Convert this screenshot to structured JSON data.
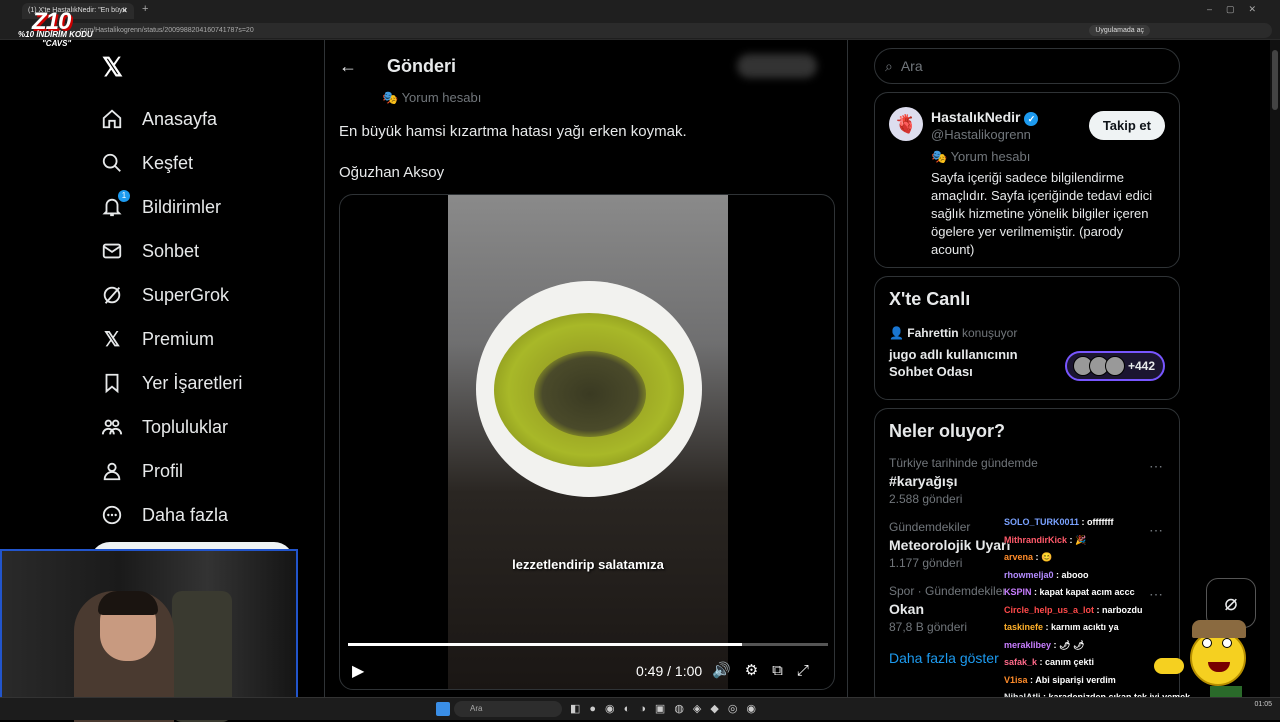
{
  "browser": {
    "tab_title": "(1) X'te HastalıkNedir: \"En büyü",
    "url": ".com/Hastalikogrenn/status/2009988204160741787s=20",
    "open_in_app": "Uygulamada aç"
  },
  "overlay": {
    "logo": "Z10",
    "promo_line1": "%10 İNDİRİM KODU",
    "promo_line2": "\"CAVS\""
  },
  "nav": {
    "items": [
      {
        "label": "Anasayfa",
        "icon": "home-icon"
      },
      {
        "label": "Keşfet",
        "icon": "search-icon"
      },
      {
        "label": "Bildirimler",
        "icon": "bell-icon",
        "badge": "1"
      },
      {
        "label": "Sohbet",
        "icon": "mail-icon"
      },
      {
        "label": "SuperGrok",
        "icon": "grok-icon"
      },
      {
        "label": "Premium",
        "icon": "x-icon"
      },
      {
        "label": "Yer İşaretleri",
        "icon": "bookmark-icon"
      },
      {
        "label": "Topluluklar",
        "icon": "communities-icon"
      },
      {
        "label": "Profil",
        "icon": "profile-icon"
      },
      {
        "label": "Daha fazla",
        "icon": "more-icon"
      }
    ]
  },
  "post": {
    "header_title": "Gönderi",
    "yorum_label": "Yorum hesabı",
    "text": "En büyük hamsi kızartma hatası yağı erken koymak.",
    "author_line": "Oğuzhan Aksoy",
    "video": {
      "caption": "lezzetlendirip salatamıza",
      "time": "0:49 / 1:00",
      "progress": 0.82
    }
  },
  "right": {
    "search_placeholder": "Ara",
    "profile": {
      "name": "HastalıkNedir",
      "handle": "@Hastalikogrenn",
      "yorum_label": "Yorum hesabı",
      "bio": "Sayfa içeriği sadece bilgilendirme amaçlıdır. Sayfa içeriğinde tedavi edici sağlık hizmetine yönelik bilgiler içeren ögelere yer verilmemiştir. (parody acount)",
      "follow_label": "Takip et"
    },
    "live": {
      "title": "X'te Canlı",
      "user": "Fahrettin",
      "status": "konuşuyor",
      "room": "jugo adlı kullanıcının Sohbet Odası",
      "count": "+442"
    },
    "trends": {
      "title": "Neler oluyor?",
      "items": [
        {
          "context": "Türkiye tarihinde gündemde",
          "name": "#karyağışı",
          "count": "2.588 gönderi"
        },
        {
          "context": "Gündemdekiler",
          "name": "Meteorolojik Uyarı",
          "count": "1.177 gönderi"
        },
        {
          "context": "Spor · Gündemdekiler",
          "name": "Okan",
          "count": "87,8 B gönderi"
        }
      ],
      "show_more": "Daha fazla göster"
    }
  },
  "chat": [
    {
      "user": "SOLO_TURK0011",
      "msg": "offfffff",
      "color": "#7aa2ff"
    },
    {
      "user": "MithrandirKick",
      "msg": "🎉",
      "color": "#ff5a6a"
    },
    {
      "user": "arvena",
      "msg": "😊",
      "color": "#ff8c2a"
    },
    {
      "user": "rhowmelja0",
      "msg": "abooo",
      "color": "#b48cff"
    },
    {
      "user": "KSPIN",
      "msg": "kapat kapat acım accc",
      "color": "#c87dff"
    },
    {
      "user": "Circle_help_us_a_lot",
      "msg": "narbozdu",
      "color": "#ff4a4a"
    },
    {
      "user": "taskinefe",
      "msg": "karnım acıktı ya",
      "color": "#ffb02a"
    },
    {
      "user": "meraklibey",
      "msg": "🌶 🌶",
      "color": "#c87dff"
    },
    {
      "user": "safak_k",
      "msg": "canım çekti",
      "color": "#ff6a8a"
    },
    {
      "user": "V1isa",
      "msg": "Abi siparişi verdim",
      "color": "#ff8c2a"
    },
    {
      "user": "NihalAtli",
      "msg": "karadenizden çıkan tek iyi yemek",
      "color": "#e7e9ea"
    }
  ],
  "taskbar": {
    "search": "Ara",
    "time": "01:05"
  }
}
